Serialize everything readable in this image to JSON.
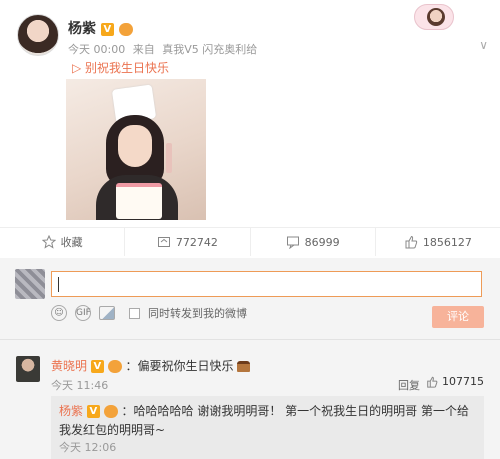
{
  "post": {
    "author": "杨紫",
    "vip_badge": "V",
    "meta_time": "今天 00:00",
    "meta_from": "来自",
    "meta_device": "真我V5 闪充奥利给",
    "music_link": "▷ 别祝我生日快乐",
    "dropdown_icon": "chevron-down"
  },
  "actions": {
    "favorite_label": "收藏",
    "repost_count": "772742",
    "comment_count": "86999",
    "like_count": "1856127"
  },
  "composer": {
    "placeholder": "",
    "repost_label": "同时转发到我的微博",
    "send_label": "评论"
  },
  "comments": [
    {
      "user": "黄晓明",
      "text": "：偏要祝你生日快乐",
      "time": "今天 11:46",
      "reply_label": "回复",
      "like_count": "107715",
      "reply": {
        "user": "杨紫",
        "text": "：哈哈哈哈哈 谢谢我明明哥！ 第一个祝我生日的明明哥 第一个给我发红包的明明哥~",
        "time": "今天 12:06"
      }
    }
  ],
  "colors": {
    "accent": "#eb7350",
    "vip": "#f7a81b",
    "input_border": "#ee9b57",
    "send_button": "#f7b39a"
  }
}
